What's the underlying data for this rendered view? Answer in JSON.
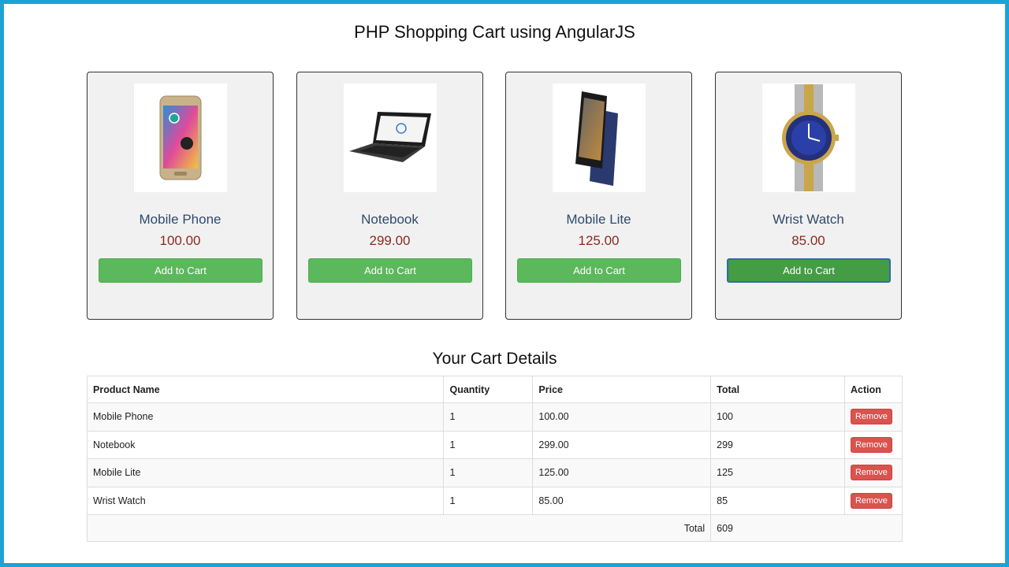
{
  "header": {
    "title": "PHP Shopping Cart using AngularJS"
  },
  "products": [
    {
      "name": "Mobile Phone",
      "price": "100.00",
      "button": "Add to Cart",
      "icon": "phone-image"
    },
    {
      "name": "Notebook",
      "price": "299.00",
      "button": "Add to Cart",
      "icon": "laptop-image"
    },
    {
      "name": "Mobile Lite",
      "price": "125.00",
      "button": "Add to Cart",
      "icon": "phone-lite-image"
    },
    {
      "name": "Wrist Watch",
      "price": "85.00",
      "button": "Add to Cart",
      "icon": "watch-image"
    }
  ],
  "cart": {
    "title": "Your Cart Details",
    "headers": [
      "Product Name",
      "Quantity",
      "Price",
      "Total",
      "Action"
    ],
    "rows": [
      {
        "name": "Mobile Phone",
        "qty": "1",
        "price": "100.00",
        "total": "100",
        "action": "Remove"
      },
      {
        "name": "Notebook",
        "qty": "1",
        "price": "299.00",
        "total": "299",
        "action": "Remove"
      },
      {
        "name": "Mobile Lite",
        "qty": "1",
        "price": "125.00",
        "total": "125",
        "action": "Remove"
      },
      {
        "name": "Wrist Watch",
        "qty": "1",
        "price": "85.00",
        "total": "85",
        "action": "Remove"
      }
    ],
    "total_label": "Total",
    "total_value": "609"
  },
  "colors": {
    "frame": "#1aa3d9",
    "add_button": "#5cb85c",
    "remove_button": "#d9534f",
    "product_name": "#2e4a6b",
    "product_price": "#8b2a1f"
  }
}
